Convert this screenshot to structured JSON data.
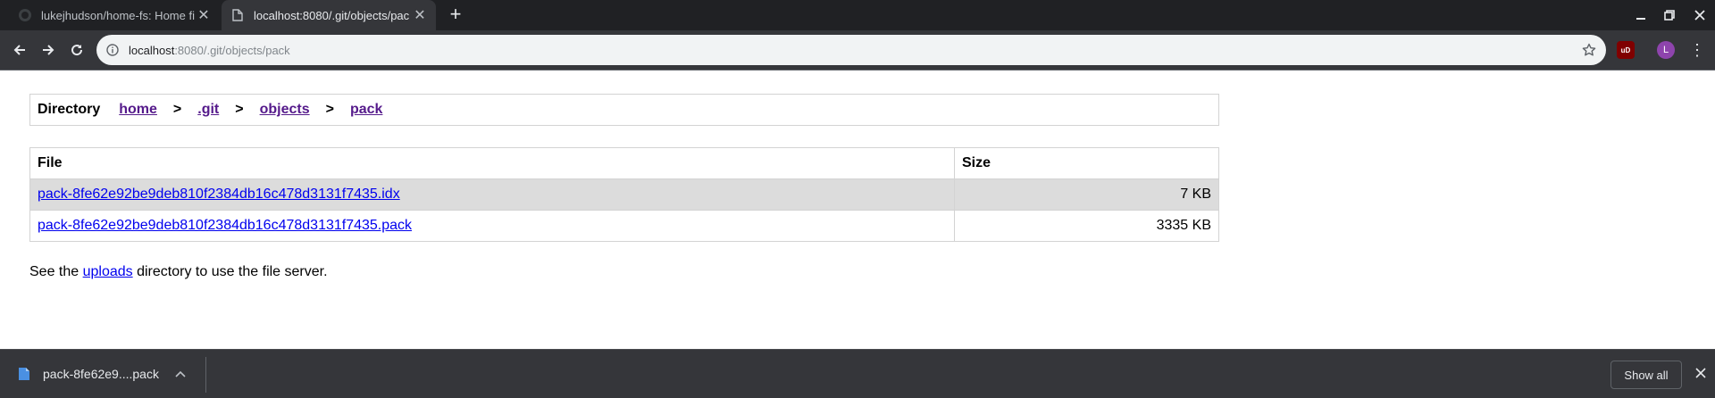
{
  "browser": {
    "tabs": [
      {
        "title": "lukejhudson/home-fs: Home fi",
        "active": false,
        "favicon": "github-icon"
      },
      {
        "title": "localhost:8080/.git/objects/pac",
        "active": true,
        "favicon": "page-icon"
      }
    ],
    "address": {
      "host": "localhost",
      "rest": ":8080/.git/objects/pack"
    },
    "extension_label": "uD",
    "avatar_initial": "L"
  },
  "breadcrumb": {
    "label": "Directory",
    "items": [
      "home",
      ".git",
      "objects",
      "pack"
    ],
    "separator": ">"
  },
  "table": {
    "headers": {
      "file": "File",
      "size": "Size"
    },
    "rows": [
      {
        "file": "pack-8fe62e92be9deb810f2384db16c478d3131f7435.idx",
        "size": "7 KB",
        "highlighted": true
      },
      {
        "file": "pack-8fe62e92be9deb810f2384db16c478d3131f7435.pack",
        "size": "3335 KB",
        "highlighted": false
      }
    ]
  },
  "footer": {
    "before": "See the ",
    "link": "uploads",
    "after": " directory to use the file server."
  },
  "downloads": {
    "item_name": "pack-8fe62e9....pack",
    "show_all": "Show all"
  },
  "colors": {
    "visited_link": "#551a8b",
    "link": "#0000ee",
    "row_highlight": "#dcdcdc"
  }
}
